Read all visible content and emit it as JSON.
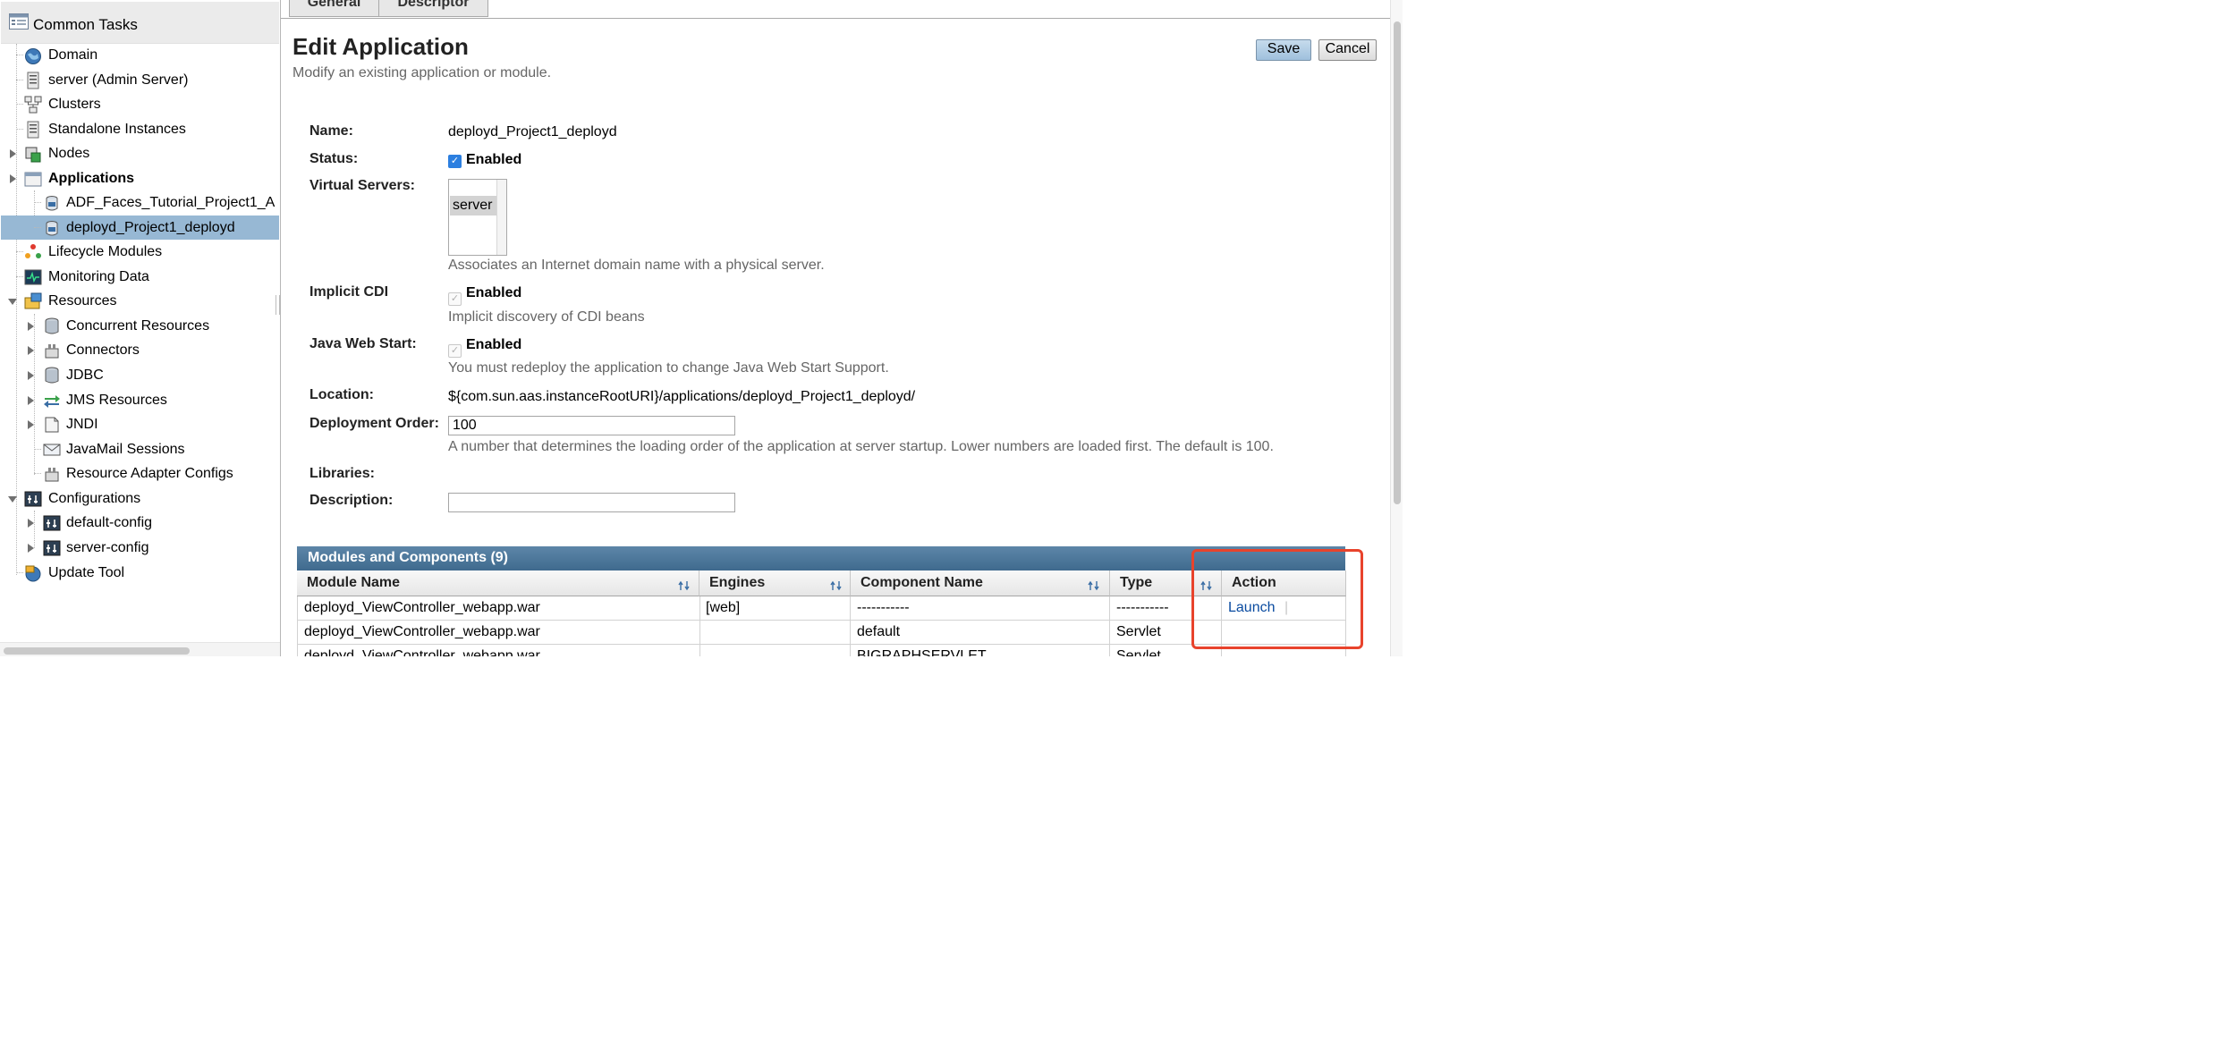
{
  "sidebar": {
    "header": "Common Tasks",
    "items": [
      {
        "label": "Domain"
      },
      {
        "label": "server (Admin Server)"
      },
      {
        "label": "Clusters"
      },
      {
        "label": "Standalone Instances"
      },
      {
        "label": "Nodes"
      },
      {
        "label": "Applications"
      },
      {
        "label": "ADF_Faces_Tutorial_Project1_A"
      },
      {
        "label": "deployd_Project1_deployd"
      },
      {
        "label": "Lifecycle Modules"
      },
      {
        "label": "Monitoring Data"
      },
      {
        "label": "Resources"
      },
      {
        "label": "Concurrent Resources"
      },
      {
        "label": "Connectors"
      },
      {
        "label": "JDBC"
      },
      {
        "label": "JMS Resources"
      },
      {
        "label": "JNDI"
      },
      {
        "label": "JavaMail Sessions"
      },
      {
        "label": "Resource Adapter Configs"
      },
      {
        "label": "Configurations"
      },
      {
        "label": "default-config"
      },
      {
        "label": "server-config"
      },
      {
        "label": "Update Tool"
      }
    ]
  },
  "tabs": [
    "General",
    "Descriptor"
  ],
  "page": {
    "title": "Edit Application",
    "subtitle": "Modify an existing application or module.",
    "save_label": "Save",
    "cancel_label": "Cancel"
  },
  "form": {
    "name_label": "Name:",
    "name_value": "deployd_Project1_deployd",
    "status_label": "Status:",
    "status_enabled": "Enabled",
    "virtual_servers_label": "Virtual Servers:",
    "virtual_servers_selected": "server",
    "virtual_servers_help": "Associates an Internet domain name with a physical server.",
    "implicit_cdi_label": "Implicit CDI",
    "implicit_cdi_enabled": "Enabled",
    "implicit_cdi_help": "Implicit discovery of CDI beans",
    "java_web_start_label": "Java Web Start:",
    "java_web_start_enabled": "Enabled",
    "java_web_start_help": "You must redeploy the application to change Java Web Start Support.",
    "location_label": "Location:",
    "location_value": "${com.sun.aas.instanceRootURI}/applications/deployd_Project1_deployd/",
    "deployment_order_label": "Deployment Order:",
    "deployment_order_value": "100",
    "deployment_order_help": "A number that determines the loading order of the application at server startup. Lower numbers are loaded first. The default is 100.",
    "libraries_label": "Libraries:",
    "description_label": "Description:",
    "description_value": ""
  },
  "modules_table": {
    "title": "Modules and Components (9)",
    "headers": [
      "Module Name",
      "Engines",
      "Component Name",
      "Type",
      "Action"
    ],
    "rows": [
      {
        "module": "deployd_ViewController_webapp.war",
        "engines": "[web]",
        "component": "-----------",
        "type": "-----------",
        "action": "Launch"
      },
      {
        "module": "deployd_ViewController_webapp.war",
        "engines": "",
        "component": "default",
        "type": "Servlet",
        "action": ""
      },
      {
        "module": "deployd_ViewController_webapp.war",
        "engines": "",
        "component": "BIGRAPHSERVLET",
        "type": "Servlet",
        "action": ""
      }
    ]
  }
}
